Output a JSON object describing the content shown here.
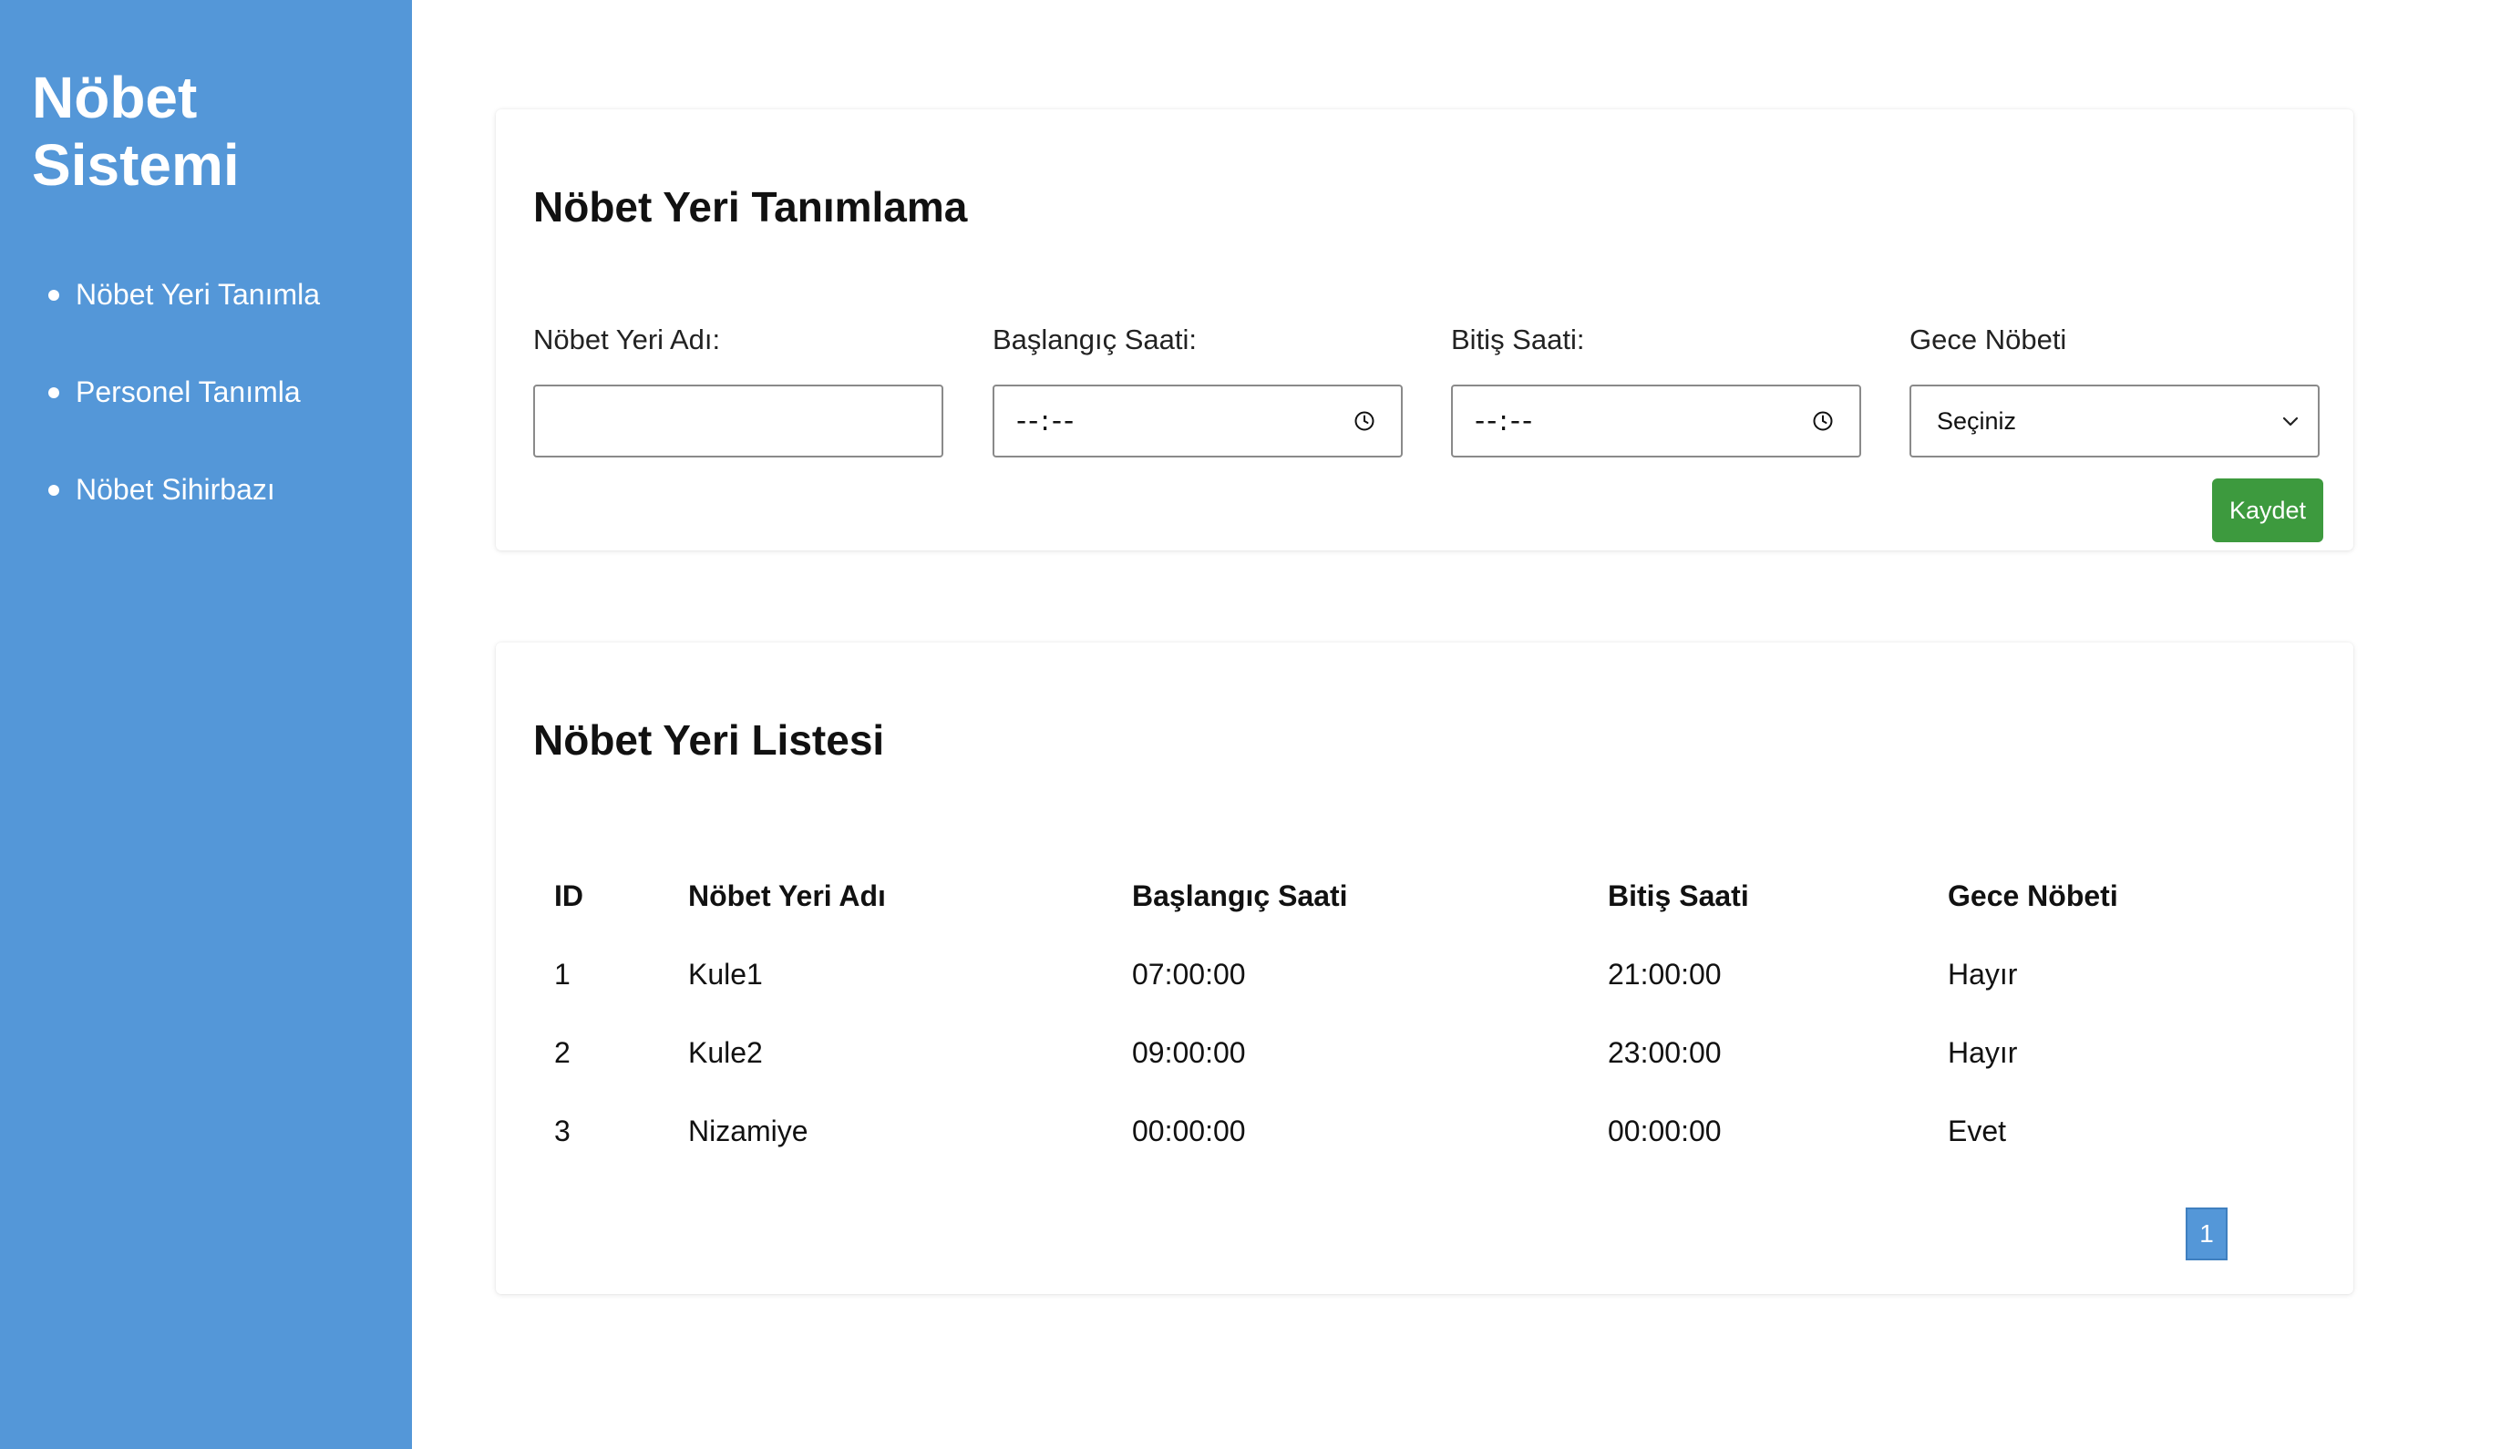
{
  "sidebar": {
    "brand": "Nöbet Sistemi",
    "items": [
      {
        "label": "Nöbet Yeri Tanımla"
      },
      {
        "label": "Personel Tanımla"
      },
      {
        "label": "Nöbet Sihirbazı"
      }
    ]
  },
  "form": {
    "title": "Nöbet Yeri Tanımlama",
    "fields": {
      "name": {
        "label": "Nöbet Yeri Adı:",
        "value": ""
      },
      "start": {
        "label": "Başlangıç Saati:",
        "value": "--:--"
      },
      "end": {
        "label": "Bitiş Saati:",
        "value": "--:--"
      },
      "night": {
        "label": "Gece Nöbeti",
        "selected": "Seçiniz"
      }
    },
    "save_label": "Kaydet",
    "save_color": "#3d9a3e"
  },
  "list": {
    "title": "Nöbet Yeri Listesi",
    "columns": [
      "ID",
      "Nöbet Yeri Adı",
      "Başlangıç Saati",
      "Bitiş Saati",
      "Gece Nöbeti"
    ],
    "rows": [
      [
        "1",
        "Kule1",
        "07:00:00",
        "21:00:00",
        "Hayır"
      ],
      [
        "2",
        "Kule2",
        "09:00:00",
        "23:00:00",
        "Hayır"
      ],
      [
        "3",
        "Nizamiye",
        "00:00:00",
        "00:00:00",
        "Evet"
      ]
    ],
    "pagination": {
      "current_page": "1"
    }
  },
  "theme": {
    "sidebar_color": "#5497d8",
    "accent": "#5497d8"
  },
  "icons": {
    "time": "clock-icon",
    "select": "chevron-down-icon",
    "nav_bullet": "bullet-icon"
  }
}
